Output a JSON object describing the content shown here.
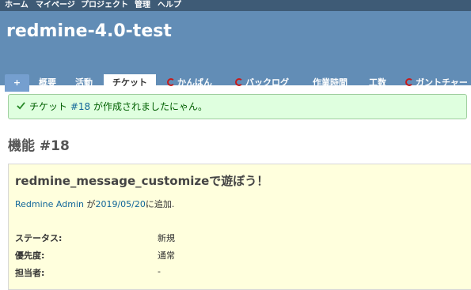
{
  "top_menu": [
    "ホーム",
    "マイページ",
    "プロジェクト",
    "管理",
    "ヘルプ"
  ],
  "project": {
    "title": "redmine-4.0-test"
  },
  "tabs": [
    {
      "label": "+"
    },
    {
      "label": "概要"
    },
    {
      "label": "活動"
    },
    {
      "label": "チケット",
      "selected": true
    },
    {
      "label": "かんばん",
      "icon": "redmine-plugin-icon"
    },
    {
      "label": "バックログ",
      "icon": "redmine-plugin-icon"
    },
    {
      "label": "作業時間"
    },
    {
      "label": "工数"
    },
    {
      "label": "ガントチャー",
      "icon": "redmine-plugin-icon"
    }
  ],
  "flash": {
    "icon": "check-icon",
    "prefix": "チケット ",
    "link": "#18",
    "suffix": " が作成されましたにゃん。"
  },
  "issue": {
    "heading": "機能 #18",
    "subject": "redmine_message_customizeで遊ぼう！",
    "author": "Redmine Admin",
    "author_sep": " が",
    "date": "2019/05/20",
    "added": "に追加.",
    "attributes": [
      {
        "label": "ステータス:",
        "value": "新規"
      },
      {
        "label": "優先度:",
        "value": "通常"
      },
      {
        "label": "担当者:",
        "value": "-"
      }
    ]
  },
  "colors": {
    "top_menu_bg": "#3e5b76",
    "header_bg": "#628db6",
    "flash_bg": "#dfffdf",
    "issue_bg": "#ffffdd",
    "link": "#116699"
  }
}
